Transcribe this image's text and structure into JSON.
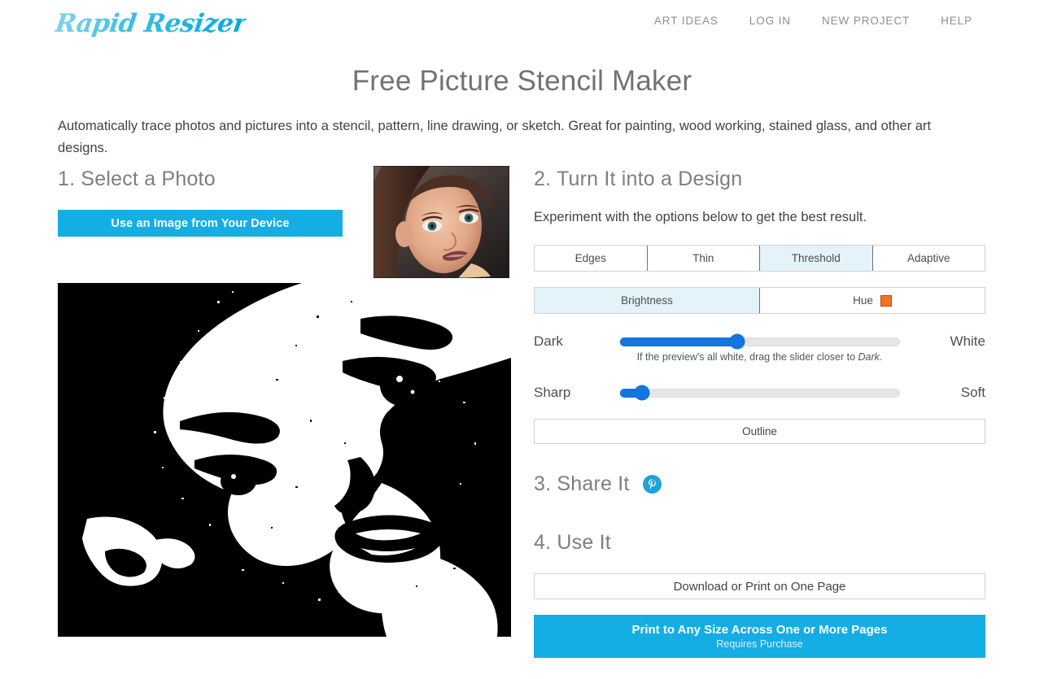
{
  "header": {
    "logo_text": "Rapid Resizer",
    "nav": [
      {
        "label": "ART IDEAS"
      },
      {
        "label": "LOG IN"
      },
      {
        "label": "NEW PROJECT"
      },
      {
        "label": "HELP"
      }
    ]
  },
  "page": {
    "title": "Free Picture Stencil Maker",
    "intro": "Automatically trace photos and pictures into a stencil, pattern, line drawing, or sketch. Great for painting, wood working, stained glass, and other art designs."
  },
  "step1": {
    "heading": "1. Select a Photo",
    "upload_button": "Use an Image from Your Device",
    "thumbnail_alt": "portrait-photo-thumbnail"
  },
  "step2": {
    "heading": "2. Turn It into a Design",
    "subtitle": "Experiment with the options below to get the best result.",
    "mode_tabs": [
      {
        "label": "Edges",
        "selected": false
      },
      {
        "label": "Thin",
        "selected": false
      },
      {
        "label": "Threshold",
        "selected": true
      },
      {
        "label": "Adaptive",
        "selected": false
      }
    ],
    "channel_tabs": [
      {
        "label": "Brightness",
        "selected": true
      },
      {
        "label": "Hue",
        "selected": false,
        "swatch_color": "#f4731c"
      }
    ],
    "threshold_slider": {
      "left_label": "Dark",
      "right_label": "White",
      "value_percent": 42
    },
    "threshold_hint_before": "If the preview's all white, drag the slider closer to ",
    "threshold_hint_italic": "Dark",
    "threshold_hint_after": ".",
    "smooth_slider": {
      "left_label": "Sharp",
      "right_label": "Soft",
      "value_percent": 8
    },
    "outline_button": "Outline",
    "preview_alt": "black-and-white-stencil-preview"
  },
  "step3": {
    "heading": "3. Share It",
    "pinterest_label": "pinterest-share"
  },
  "step4": {
    "heading": "4. Use It",
    "download_button": "Download or Print on One Page",
    "print_button_line1": "Print to Any Size Across One or More Pages",
    "print_button_line2": "Requires Purchase"
  },
  "colors": {
    "accent_cyan": "#14ade4",
    "tab_selected": "#e3f3f9",
    "slider_blue": "#1275e0",
    "hue_swatch": "#f4731c",
    "pinterest_blue": "#1fa2dc"
  }
}
